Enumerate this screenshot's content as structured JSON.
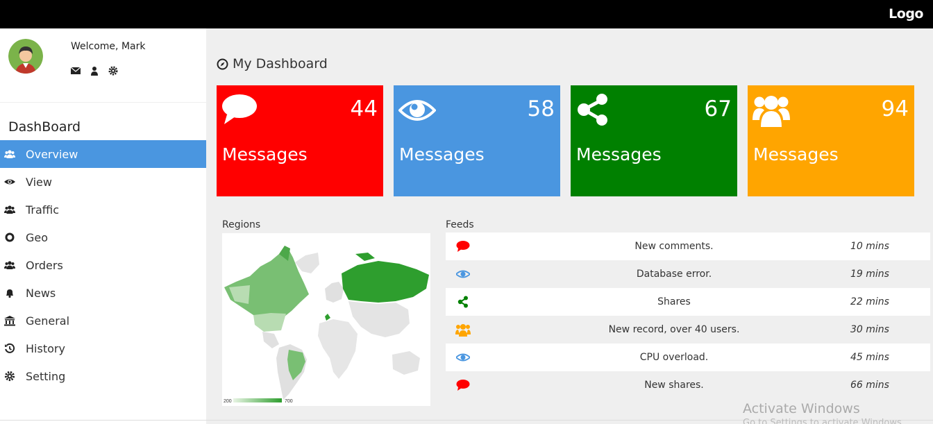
{
  "header": {
    "logo": "Logo"
  },
  "profile": {
    "welcome": "Welcome, Mark"
  },
  "sidebar": {
    "title": "DashBoard",
    "items": [
      {
        "label": "Overview",
        "icon": "users-icon"
      },
      {
        "label": "View",
        "icon": "eye-icon"
      },
      {
        "label": "Traffic",
        "icon": "users-icon"
      },
      {
        "label": "Geo",
        "icon": "circle-icon"
      },
      {
        "label": "Orders",
        "icon": "users-icon"
      },
      {
        "label": "News",
        "icon": "bell-icon"
      },
      {
        "label": "General",
        "icon": "bank-icon"
      },
      {
        "label": "History",
        "icon": "history-icon"
      },
      {
        "label": "Setting",
        "icon": "gear-icon"
      }
    ]
  },
  "main": {
    "title": "My Dashboard",
    "cards": [
      {
        "value": "44",
        "label": "Messages",
        "color": "#ff0000",
        "icon": "comment-icon"
      },
      {
        "value": "58",
        "label": "Messages",
        "color": "#4a96e0",
        "icon": "eye-icon"
      },
      {
        "value": "67",
        "label": "Messages",
        "color": "#008000",
        "icon": "share-icon"
      },
      {
        "value": "94",
        "label": "Messages",
        "color": "#ffa500",
        "icon": "users-icon"
      }
    ],
    "regions": {
      "label": "Regions",
      "legend_min": "200",
      "legend_max": "700"
    },
    "feeds": {
      "label": "Feeds",
      "items": [
        {
          "text": "New comments.",
          "time": "10 mins",
          "icon": "comment-icon",
          "color": "#ff0000"
        },
        {
          "text": "Database error.",
          "time": "19 mins",
          "icon": "eye-icon",
          "color": "#4a96e0"
        },
        {
          "text": "Shares",
          "time": "22 mins",
          "icon": "share-icon",
          "color": "#008000"
        },
        {
          "text": "New record, over 40 users.",
          "time": "30 mins",
          "icon": "users-icon",
          "color": "#ffa500"
        },
        {
          "text": "CPU overload.",
          "time": "45 mins",
          "icon": "eye-icon",
          "color": "#4a96e0"
        },
        {
          "text": "New shares.",
          "time": "66 mins",
          "icon": "comment-icon",
          "color": "#ff0000"
        }
      ]
    }
  },
  "watermark": {
    "line1": "Activate Windows",
    "line2": "Go to Settings to activate Windows."
  }
}
